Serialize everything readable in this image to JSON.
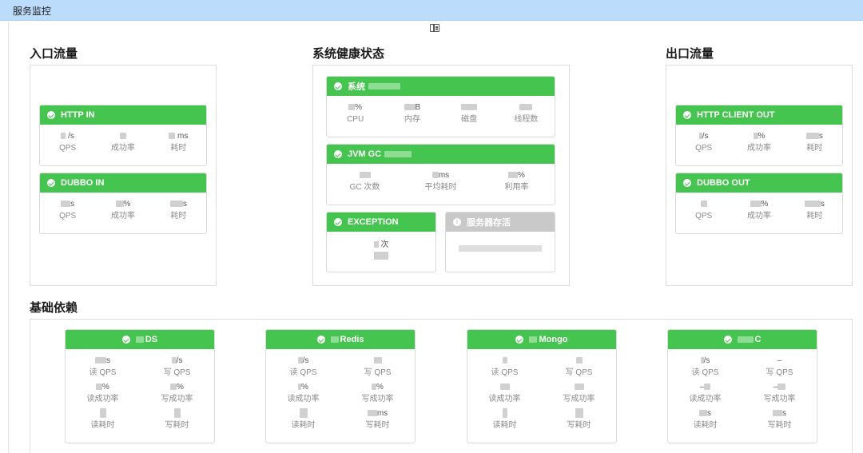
{
  "window": {
    "title": "服务监控"
  },
  "toolbar": {
    "toggle_icon": "layout-icon"
  },
  "sections": {
    "inbound": "入口流量",
    "health": "系统健康状态",
    "outbound": "出口流量",
    "infra": "基础依赖"
  },
  "inbound": {
    "http": {
      "title": "HTTP IN",
      "metrics": [
        {
          "value": "/s",
          "label": "QPS"
        },
        {
          "value": "",
          "label": "成功率"
        },
        {
          "value": "ms",
          "label": "耗时"
        }
      ]
    },
    "dubbo": {
      "title": "DUBBO IN",
      "metrics": [
        {
          "value": "s",
          "label": "QPS"
        },
        {
          "value": "%",
          "label": "成功率"
        },
        {
          "value": "s",
          "label": "耗时"
        }
      ]
    }
  },
  "health": {
    "system": {
      "title": "系统",
      "metrics": [
        {
          "value": "%",
          "label": "CPU"
        },
        {
          "value": "B",
          "label": "内存"
        },
        {
          "value": "",
          "label": "磁盘"
        },
        {
          "value": "",
          "label": "线程数"
        }
      ]
    },
    "jvm": {
      "title": "JVM GC",
      "metrics": [
        {
          "value": "",
          "label": "GC 次数"
        },
        {
          "value": "ms",
          "label": "平均耗时"
        },
        {
          "value": "%",
          "label": "利用率"
        }
      ]
    },
    "exception": {
      "title": "EXCEPTION",
      "value": "次"
    },
    "alive": {
      "title": "服务器存活"
    }
  },
  "outbound": {
    "http": {
      "title": "HTTP CLIENT OUT",
      "metrics": [
        {
          "value": "/s",
          "label": "QPS"
        },
        {
          "value": "%",
          "label": "成功率"
        },
        {
          "value": "s",
          "label": "耗时"
        }
      ]
    },
    "dubbo": {
      "title": "DUBBO OUT",
      "metrics": [
        {
          "value": "",
          "label": "QPS"
        },
        {
          "value": "%",
          "label": "成功率"
        },
        {
          "value": "s",
          "label": "耗时"
        }
      ]
    }
  },
  "infra": [
    {
      "title": "DS",
      "cells": [
        {
          "value": "s",
          "label": "读 QPS"
        },
        {
          "value": "/s",
          "label": "写 QPS"
        },
        {
          "value": "%",
          "label": "读成功率"
        },
        {
          "value": "%",
          "label": "写成功率"
        },
        {
          "value": "",
          "label": "读耗时"
        },
        {
          "value": "",
          "label": "写耗时"
        }
      ]
    },
    {
      "title": "Redis",
      "cells": [
        {
          "value": "/s",
          "label": "读 QPS"
        },
        {
          "value": "",
          "label": "写 QPS"
        },
        {
          "value": "%",
          "label": "读成功率"
        },
        {
          "value": "%",
          "label": "写成功率"
        },
        {
          "value": "",
          "label": "读耗时"
        },
        {
          "value": "ms",
          "label": "写耗时"
        }
      ]
    },
    {
      "title": "Mongo",
      "cells": [
        {
          "value": "",
          "label": "读 QPS"
        },
        {
          "value": "",
          "label": "写 QPS"
        },
        {
          "value": "",
          "label": "读成功率"
        },
        {
          "value": "",
          "label": "写成功率"
        },
        {
          "value": "",
          "label": "读耗时"
        },
        {
          "value": "",
          "label": "写耗时"
        }
      ]
    },
    {
      "title": "C",
      "cells": [
        {
          "value": "/s",
          "label": "读 QPS"
        },
        {
          "value": "–",
          "label": "写 QPS"
        },
        {
          "value": "–",
          "label": "读成功率"
        },
        {
          "value": "–",
          "label": "写成功率"
        },
        {
          "value": "s",
          "label": "读耗时"
        },
        {
          "value": "s",
          "label": "写耗时"
        }
      ]
    }
  ],
  "colors": {
    "ok": "#45c44f",
    "inactive": "#c9c9c9",
    "topbar": "#bcdcfb"
  }
}
